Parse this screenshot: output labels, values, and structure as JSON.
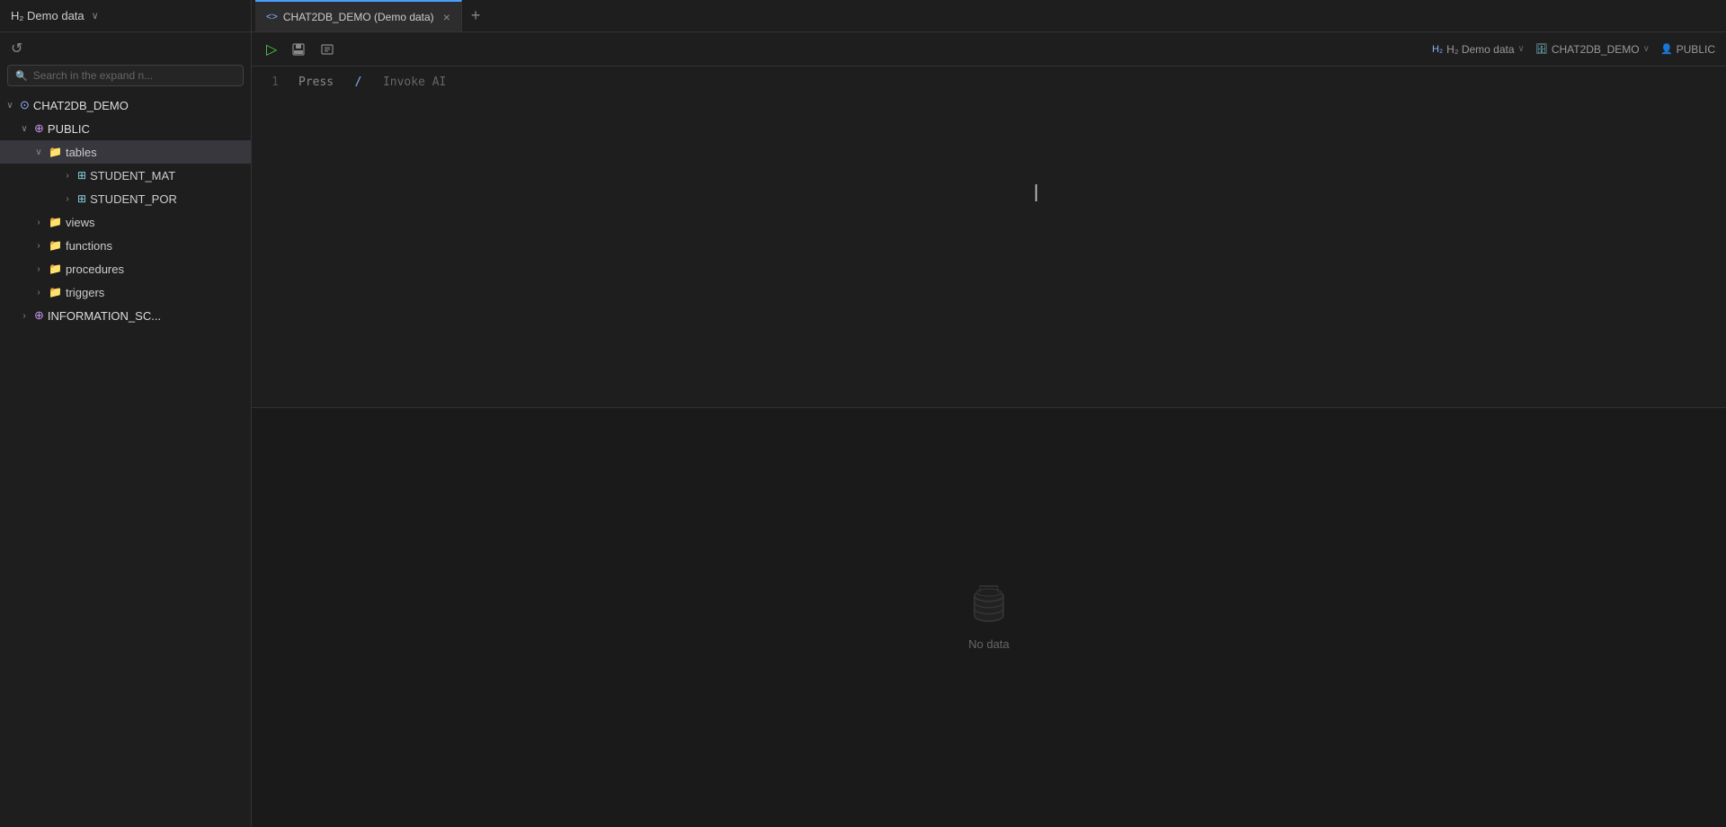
{
  "titleBar": {
    "windowTitle": "H₂ Demo data",
    "arrowSymbol": "∨",
    "tab": {
      "icon": "<>",
      "label": "CHAT2DB_DEMO (Demo data)",
      "closeSymbol": "×"
    },
    "addTabSymbol": "+"
  },
  "headerRight": {
    "connection": "H₂ Demo data",
    "arrow": "∨",
    "database": "CHAT2DB_DEMO",
    "dbArrow": "∨",
    "schema": "PUBLIC"
  },
  "sidebar": {
    "refreshSymbol": "↺",
    "searchPlaceholder": "Search in the expand n...",
    "tree": {
      "chatDb": {
        "chevronExpanded": "∨",
        "icon": "⊙",
        "label": "CHAT2DB_DEMO"
      },
      "public": {
        "chevronExpanded": "∨",
        "icon": "⊕",
        "label": "PUBLIC"
      },
      "tables": {
        "chevronExpanded": "∨",
        "icon": "📁",
        "label": "tables",
        "isSelected": true,
        "children": [
          {
            "chevron": ">",
            "icon": "⊞",
            "label": "STUDENT_MAT"
          },
          {
            "chevron": ">",
            "icon": "⊞",
            "label": "STUDENT_POR"
          }
        ]
      },
      "views": {
        "chevron": ">",
        "icon": "📁",
        "label": "views"
      },
      "functions": {
        "chevron": ">",
        "icon": "📁",
        "label": "functions"
      },
      "procedures": {
        "chevron": ">",
        "icon": "📁",
        "label": "procedures"
      },
      "triggers": {
        "chevron": ">",
        "icon": "📁",
        "label": "triggers"
      },
      "infoSchema": {
        "chevron": ">",
        "icon": "⊕",
        "label": "INFORMATION_SC..."
      }
    }
  },
  "editor": {
    "lineNumber": "1",
    "placeholderPress": "Press",
    "placeholderSlash": "/",
    "placeholderInvoke": "Invoke AI",
    "toolbar": {
      "runSymbol": "▷",
      "saveSymbol": "💾",
      "formatSymbol": "⊡"
    }
  },
  "results": {
    "noDataText": "No data"
  }
}
